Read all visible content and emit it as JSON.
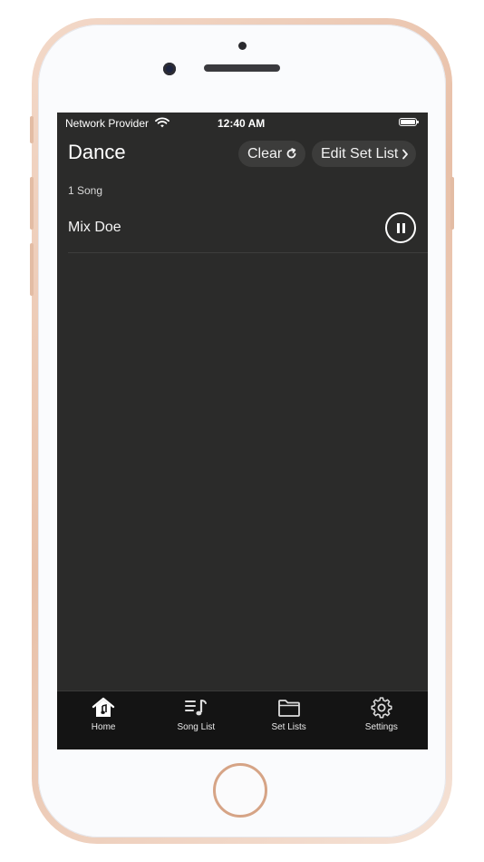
{
  "status_bar": {
    "carrier": "Network Provider",
    "time": "12:40 AM"
  },
  "header": {
    "title": "Dance",
    "clear_label": "Clear",
    "edit_label": "Edit Set List"
  },
  "set_list": {
    "count_label": "1 Song",
    "songs": [
      {
        "title": "Mix Doe",
        "state": "playing"
      }
    ]
  },
  "tab_bar": {
    "tabs": [
      {
        "label": "Home",
        "icon": "home-music-icon"
      },
      {
        "label": "Song List",
        "icon": "song-list-icon"
      },
      {
        "label": "Set Lists",
        "icon": "folder-icon"
      },
      {
        "label": "Settings",
        "icon": "gear-icon"
      }
    ]
  },
  "colors": {
    "screen_bg": "#2b2b2a",
    "tab_bar_bg": "#141414",
    "pill_bg": "#3c3c3b",
    "frame": "#e8c0a8"
  }
}
